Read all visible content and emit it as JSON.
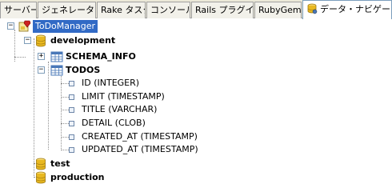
{
  "tabs": [
    {
      "label": "サーバー"
    },
    {
      "label": "ジェネレーター"
    },
    {
      "label": "Rake タスク"
    },
    {
      "label": "コンソール"
    },
    {
      "label": "Rails プラグイン"
    },
    {
      "label": "RubyGems"
    },
    {
      "label": "データ・ナビゲーター",
      "icon": "database-icon",
      "active": true
    }
  ],
  "tree": {
    "root": {
      "label": "ToDoManager",
      "icon": "ruby-app-icon",
      "expanded": true
    },
    "environments": [
      {
        "label": "development",
        "expanded": true
      },
      {
        "label": "test",
        "expanded": false
      },
      {
        "label": "production",
        "expanded": false
      }
    ],
    "tables": [
      {
        "label": "SCHEMA_INFO",
        "expanded": false
      },
      {
        "label": "TODOS",
        "expanded": true
      }
    ],
    "columns": [
      {
        "label": "ID (INTEGER)"
      },
      {
        "label": "LIMIT (TIMESTAMP)"
      },
      {
        "label": "TITLE (VARCHAR)"
      },
      {
        "label": "DETAIL (CLOB)"
      },
      {
        "label": "CREATED_AT (TIMESTAMP)"
      },
      {
        "label": "UPDATED_AT (TIMESTAMP)"
      }
    ]
  },
  "colors": {
    "selection": "#316ac5",
    "db_yellow": "#e8b820",
    "table_blue": "#4a78b8"
  }
}
